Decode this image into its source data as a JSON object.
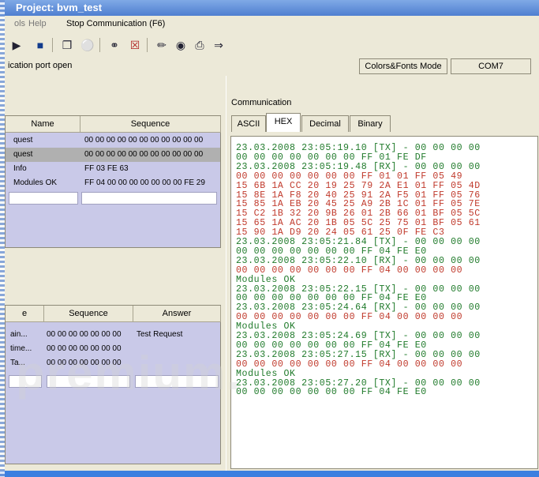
{
  "window": {
    "title": "Project: bvm_test"
  },
  "menu": {
    "items": [
      "ols",
      "Help",
      "Stop Communication  (F6)"
    ]
  },
  "toolbar": {
    "icons": [
      "play-icon",
      "stop-icon",
      "copy-icon",
      "key-icon",
      "binoculars-icon",
      "image-icon",
      "text-icon",
      "camera-icon",
      "printer-icon",
      "export-icon"
    ]
  },
  "status": {
    "left_text": "ication port open",
    "mode_text": "Colors&Fonts Mode",
    "port_text": "COM7"
  },
  "requests_table": {
    "headers": [
      "Name",
      "Sequence"
    ],
    "rows": [
      {
        "name": "quest",
        "sequence": "00 00 00 00 00 00 00 00 00 00 00"
      },
      {
        "name": "quest",
        "sequence": "00 00 00 00 00 00 00 00 00 00 00"
      },
      {
        "name": "Info",
        "sequence": "FF 03 FE 63"
      },
      {
        "name": "Modules OK",
        "sequence": "FF 04 00 00 00 00 00 00 00 FE 29"
      }
    ]
  },
  "answers_table": {
    "headers": [
      "e",
      "Sequence",
      "Answer"
    ],
    "rows": [
      {
        "c0": "ain...",
        "sequence": "00 00 00 00 00 00 00",
        "answer": "Test Request"
      },
      {
        "c0": "time...",
        "sequence": "00 00 00 00 00 00 00",
        "answer": ""
      },
      {
        "c0": "Ta...",
        "sequence": "00 00 00 00 00 00 00",
        "answer": ""
      }
    ]
  },
  "communication": {
    "label": "Communication",
    "tabs": [
      "ASCII",
      "HEX",
      "Decimal",
      "Binary"
    ],
    "active_tab": "HEX"
  },
  "log_lines": [
    {
      "cls": "tx",
      "text": "23.03.2008 23:05:19.10 [TX] - 00 00 00 00"
    },
    {
      "cls": "tx",
      "text": "00 00 00 00 00 00 00 FF 01 FE DF"
    },
    {
      "cls": "tx",
      "text": "23.03.2008 23:05:19.48 [RX] - 00 00 00 00"
    },
    {
      "cls": "rx",
      "text": "00 00 00 00 00 00 00 FF 01 01 FF 05 49"
    },
    {
      "cls": "rx",
      "text": "15 6B 1A CC 20 19 25 79 2A E1 01 FF 05 4D"
    },
    {
      "cls": "rx",
      "text": "15 8E 1A F8 20 40 25 91 2A F5 01 FF 05 76"
    },
    {
      "cls": "rx",
      "text": "15 85 1A EB 20 45 25 A9 2B 1C 01 FF 05 7E"
    },
    {
      "cls": "rx",
      "text": "15 C2 1B 32 20 9B 26 01 2B 66 01 BF 05 5C"
    },
    {
      "cls": "rx",
      "text": "15 65 1A AC 20 1B 05 5C 25 75 01 BF 05 61"
    },
    {
      "cls": "rx",
      "text": "15 90 1A D9 20 24 05 61 25 0F FE C3"
    },
    {
      "cls": "tx",
      "text": "23.03.2008 23:05:21.84 [TX] - 00 00 00 00"
    },
    {
      "cls": "tx",
      "text": "00 00 00 00 00 00 00 FF 04 FE E0"
    },
    {
      "cls": "tx",
      "text": "23.03.2008 23:05:22.10 [RX] - 00 00 00 00"
    },
    {
      "cls": "rx",
      "text": "00 00 00 00 00 00 00 FF 04 00 00 00 00"
    },
    {
      "cls": "msg",
      "text": "Modules OK"
    },
    {
      "cls": "tx",
      "text": "23.03.2008 23:05:22.15 [TX] - 00 00 00 00"
    },
    {
      "cls": "tx",
      "text": "00 00 00 00 00 00 00 FF 04 FE E0"
    },
    {
      "cls": "tx",
      "text": "23.03.2008 23:05:24.64 [RX] - 00 00 00 00"
    },
    {
      "cls": "rx",
      "text": "00 00 00 00 00 00 00 FF 04 00 00 00 00"
    },
    {
      "cls": "msg",
      "text": "Modules OK"
    },
    {
      "cls": "tx",
      "text": "23.03.2008 23:05:24.69 [TX] - 00 00 00 00"
    },
    {
      "cls": "tx",
      "text": "00 00 00 00 00 00 00 FF 04 FE E0"
    },
    {
      "cls": "tx",
      "text": "23.03.2008 23:05:27.15 [RX] - 00 00 00 00"
    },
    {
      "cls": "rx",
      "text": "00 00 00 00 00 00 00 FF 04 00 00 00 00"
    },
    {
      "cls": "msg",
      "text": "Modules OK"
    },
    {
      "cls": "tx",
      "text": "23.03.2008 23:05:27.20 [TX] - 00 00 00 00"
    },
    {
      "cls": "tx",
      "text": "00 00 00 00 00 00 00 FF 04 FE E0"
    }
  ]
}
